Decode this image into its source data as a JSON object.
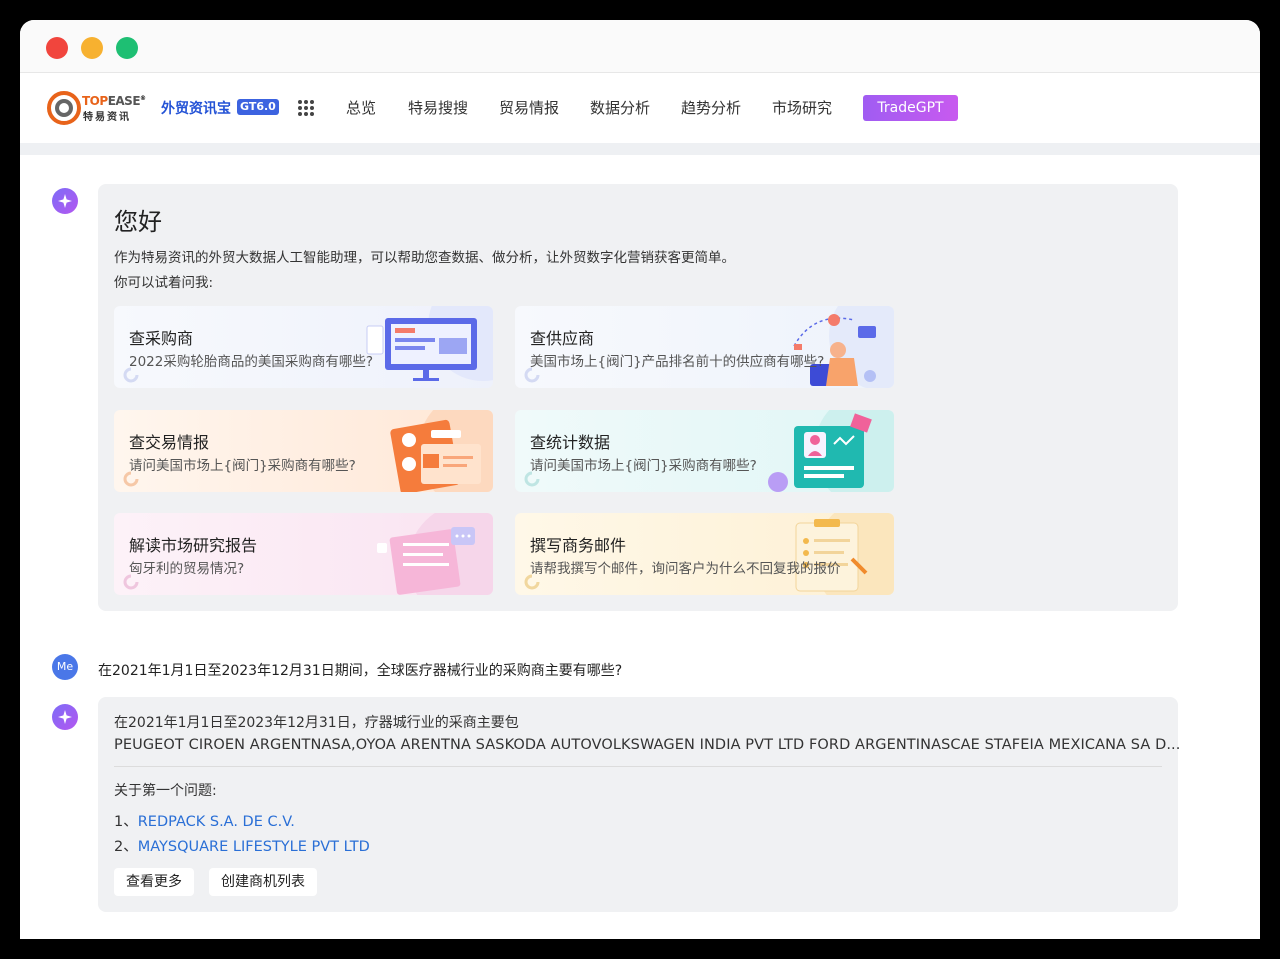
{
  "window": {
    "traffic_lights": [
      "close",
      "minimize",
      "maximize"
    ]
  },
  "nav": {
    "brand_top_a": "TOP",
    "brand_top_b": "EASE",
    "brand_reg": "®",
    "brand_bottom": "特易资讯",
    "product": "外贸资讯宝",
    "version_badge": "GT6.0",
    "menu_icon": "grid-icon",
    "items": [
      "总览",
      "特易搜搜",
      "贸易情报",
      "数据分析",
      "趋势分析",
      "市场研究"
    ],
    "tradegpt": "TradeGPT",
    "colors": {
      "accent": "#2453d6",
      "tradegpt": "#b35af0",
      "brand_orange": "#e8631a"
    }
  },
  "greeting": {
    "title": "您好",
    "intro": "作为特易资讯的外贸大数据人工智能助理，可以帮助您查数据、做分析，让外贸数字化营销获客更简单。",
    "prompt": "你可以试着问我:",
    "cards": [
      {
        "title": "查采购商",
        "subtitle": "2022采购轮胎商品的美国采购商有哪些?"
      },
      {
        "title": "查供应商",
        "subtitle": "美国市场上{阀门}产品排名前十的供应商有哪些?"
      },
      {
        "title": "查交易情报",
        "subtitle": "请问美国市场上{阀门}采购商有哪些?"
      },
      {
        "title": "查统计数据",
        "subtitle": "请问美国市场上{阀门}采购商有哪些?"
      },
      {
        "title": "解读市场研究报告",
        "subtitle": "匈牙利的贸易情况?"
      },
      {
        "title": "撰写商务邮件",
        "subtitle": "请帮我撰写个邮件，询问客户为什么不回复我的报价"
      }
    ]
  },
  "user": {
    "avatar": "Me",
    "question": "在2021年1月1日至2023年12月31日期间，全球医疗器械行业的采购商主要有哪些?"
  },
  "answer": {
    "line1": "在2021年1月1日至2023年12月31日，疗器城行业的采商主要包",
    "line2": "PEUGEOT CIROEN ARGENTNASA,OYOA ARENTNA SASKODA AUTOVOLKSWAGEN INDIA PVT LTD FORD ARGENTINASCAE STAFEIA MEXICANA SA D...",
    "section": "关于第一个问题:",
    "items": [
      {
        "num": "1、",
        "name": "REDPACK S.A. DE C.V."
      },
      {
        "num": "2、",
        "name": "MAYSQUARE LIFESTYLE PVT LTD"
      }
    ],
    "buttons": [
      "查看更多",
      "创建商机列表"
    ],
    "link_color": "#2a6fd6"
  }
}
